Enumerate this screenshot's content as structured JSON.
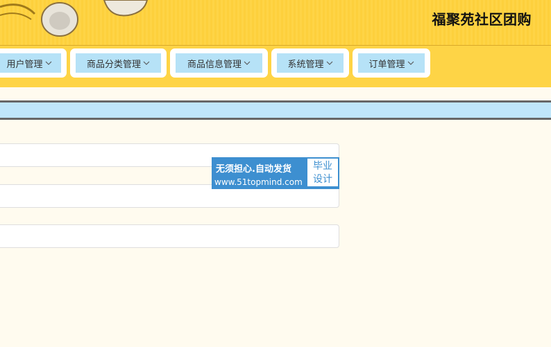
{
  "header": {
    "title": "福聚苑社区团购",
    "decoration_icon": "earphones-icon"
  },
  "nav": {
    "items": [
      {
        "label": "用户管理"
      },
      {
        "label": "商品分类管理"
      },
      {
        "label": "商品信息管理"
      },
      {
        "label": "系统管理"
      },
      {
        "label": "订单管理"
      }
    ],
    "caret_icon": "chevron-down-icon"
  },
  "form": {
    "fields": [
      {
        "value": "",
        "placeholder": ""
      },
      {
        "value": "",
        "placeholder": ""
      },
      {
        "value": "",
        "placeholder": ""
      }
    ]
  },
  "watermark": {
    "line1": "无须担心.自动发货",
    "line2": "www.51topmind.com",
    "badge_line1": "毕业",
    "badge_line2": "设计"
  },
  "colors": {
    "header_bg": "#fed446",
    "nav_item_bg": "#b6e2f7",
    "strip_bg": "#bfe6fa",
    "page_bg": "#fffbef",
    "watermark_bg": "#3d8fd0"
  }
}
